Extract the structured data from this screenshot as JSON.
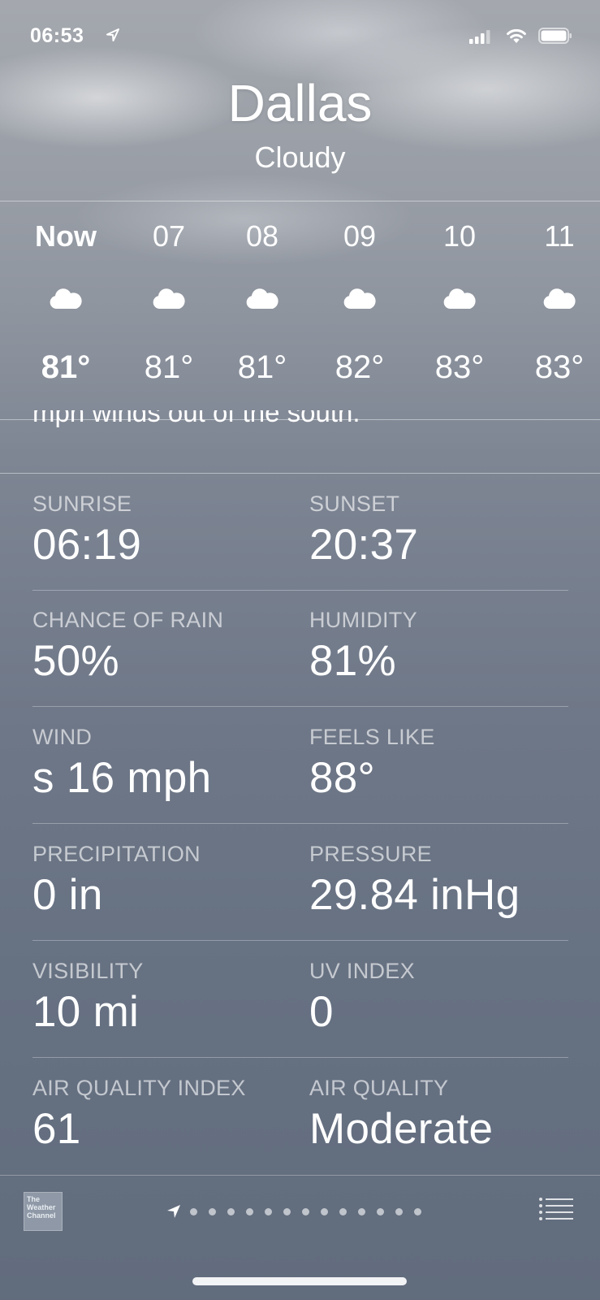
{
  "status_bar": {
    "time": "06:53"
  },
  "header": {
    "city": "Dallas",
    "condition": "Cloudy"
  },
  "hourly": [
    {
      "label": "Now",
      "icon": "cloud-icon",
      "temp": "81°"
    },
    {
      "label": "07",
      "icon": "cloud-icon",
      "temp": "81°"
    },
    {
      "label": "08",
      "icon": "cloud-icon",
      "temp": "81°"
    },
    {
      "label": "09",
      "icon": "cloud-icon",
      "temp": "82°"
    },
    {
      "label": "10",
      "icon": "cloud-icon",
      "temp": "83°"
    },
    {
      "label": "11",
      "icon": "cloud-icon",
      "temp": "83°"
    }
  ],
  "summary_partial": "mph winds out of the south.",
  "details": [
    {
      "left": {
        "label": "SUNRISE",
        "value": "06:19"
      },
      "right": {
        "label": "SUNSET",
        "value": "20:37"
      }
    },
    {
      "left": {
        "label": "CHANCE OF RAIN",
        "value": "50%"
      },
      "right": {
        "label": "HUMIDITY",
        "value": "81%"
      }
    },
    {
      "left": {
        "label": "WIND",
        "value": "s 16 mph"
      },
      "right": {
        "label": "FEELS LIKE",
        "value": "88°"
      }
    },
    {
      "left": {
        "label": "PRECIPITATION",
        "value": "0 in"
      },
      "right": {
        "label": "PRESSURE",
        "value": "29.84 inHg"
      }
    },
    {
      "left": {
        "label": "VISIBILITY",
        "value": "10 mi"
      },
      "right": {
        "label": "UV INDEX",
        "value": "0"
      }
    },
    {
      "left": {
        "label": "AIR QUALITY INDEX",
        "value": "61"
      },
      "right": {
        "label": "AIR QUALITY",
        "value": "Moderate"
      }
    }
  ],
  "footer": {
    "logo_text": [
      "The",
      "Weather",
      "Channel"
    ],
    "page_dot_count": 13
  }
}
